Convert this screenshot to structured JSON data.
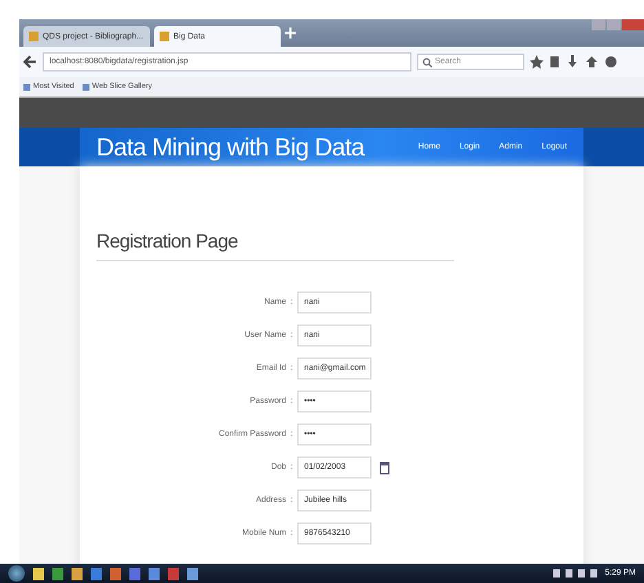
{
  "browser": {
    "tabs": [
      {
        "label": "QDS project - Bibliograph...",
        "selected": false
      },
      {
        "label": "Big Data",
        "selected": true
      }
    ],
    "url": "localhost:8080/bigdata/registration.jsp",
    "search": {
      "placeholder": "Search"
    },
    "bookmarks": [
      "Most Visited",
      "Web Slice Gallery"
    ]
  },
  "header": {
    "title": "Data Mining with Big Data",
    "nav": [
      "Home",
      "Login",
      "Admin",
      "Logout"
    ]
  },
  "page": {
    "heading": "Registration Page",
    "fields": [
      {
        "label": "Name",
        "colon": ":",
        "value": "nani"
      },
      {
        "label": "User Name",
        "colon": ":",
        "value": "nani"
      },
      {
        "label": "Email Id",
        "colon": ":",
        "value": "nani@gmail.com"
      },
      {
        "label": "Password",
        "colon": ":",
        "value": "••••"
      },
      {
        "label": "Confirm Password",
        "colon": ":",
        "value": "••••"
      },
      {
        "label": "Dob",
        "colon": ":",
        "value": "01/02/2003",
        "kind": "date"
      },
      {
        "label": "Address",
        "colon": ":",
        "value": "Jubilee hills"
      },
      {
        "label": "Mobile Num",
        "colon": ":",
        "value": "9876543210"
      }
    ]
  },
  "taskbar": {
    "clock": "5:29 PM"
  }
}
